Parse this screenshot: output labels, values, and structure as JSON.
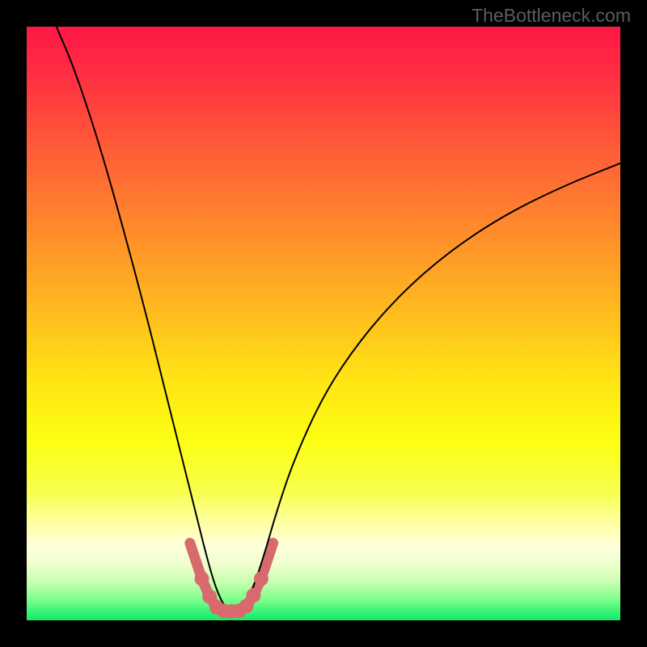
{
  "watermark": "TheBottleneck.com",
  "chart_data": {
    "type": "line",
    "title": "",
    "xlabel": "",
    "ylabel": "",
    "xlim": [
      0,
      100
    ],
    "ylim": [
      0,
      100
    ],
    "grid": false,
    "legend": false,
    "background": {
      "type": "vertical-gradient",
      "stops": [
        {
          "offset": 0.0,
          "color": "#ff1846"
        },
        {
          "offset": 0.08,
          "color": "#ff2e42"
        },
        {
          "offset": 0.2,
          "color": "#ff5a38"
        },
        {
          "offset": 0.34,
          "color": "#ff8a2c"
        },
        {
          "offset": 0.48,
          "color": "#ffbb1e"
        },
        {
          "offset": 0.6,
          "color": "#ffe614"
        },
        {
          "offset": 0.7,
          "color": "#fcff14"
        },
        {
          "offset": 0.78,
          "color": "#f7ff4a"
        },
        {
          "offset": 0.845,
          "color": "#ffffb0"
        },
        {
          "offset": 0.875,
          "color": "#ffffdc"
        },
        {
          "offset": 0.905,
          "color": "#f0ffce"
        },
        {
          "offset": 0.935,
          "color": "#c8ffb0"
        },
        {
          "offset": 0.965,
          "color": "#7fff8c"
        },
        {
          "offset": 0.985,
          "color": "#38f576"
        },
        {
          "offset": 1.0,
          "color": "#18e86a"
        }
      ]
    },
    "series": [
      {
        "name": "bottleneck-curve",
        "stroke": "#000000",
        "stroke_width": 2,
        "x": [
          5.0,
          8.0,
          12.0,
          16.0,
          20.0,
          23.0,
          26.0,
          28.5,
          30.5,
          32.0,
          33.5,
          35.0,
          36.5,
          38.0,
          40.0,
          42.0,
          45.0,
          50.0,
          56.0,
          63.0,
          71.0,
          80.0,
          90.0,
          100.0
        ],
        "values": [
          100.0,
          93.0,
          81.0,
          67.0,
          52.0,
          40.0,
          28.0,
          18.0,
          10.0,
          5.0,
          2.0,
          1.5,
          2.0,
          5.0,
          11.0,
          18.0,
          27.0,
          38.0,
          47.0,
          55.0,
          62.0,
          68.0,
          73.0,
          77.0
        ]
      }
    ],
    "markers": {
      "name": "highlight-points",
      "color": "#d86a6e",
      "stroke": "#d86a6e",
      "radius_small": 5,
      "radius_large": 9,
      "points": [
        {
          "x": 27.5,
          "y": 13.0,
          "r": 5
        },
        {
          "x": 29.5,
          "y": 7.0,
          "r": 9
        },
        {
          "x": 30.8,
          "y": 4.0,
          "r": 9
        },
        {
          "x": 32.0,
          "y": 2.2,
          "r": 9
        },
        {
          "x": 33.2,
          "y": 1.6,
          "r": 9
        },
        {
          "x": 34.5,
          "y": 1.5,
          "r": 9
        },
        {
          "x": 35.8,
          "y": 1.6,
          "r": 9
        },
        {
          "x": 37.0,
          "y": 2.4,
          "r": 9
        },
        {
          "x": 38.2,
          "y": 4.2,
          "r": 9
        },
        {
          "x": 39.5,
          "y": 7.0,
          "r": 9
        },
        {
          "x": 41.5,
          "y": 13.0,
          "r": 5
        }
      ],
      "connector": true
    }
  }
}
